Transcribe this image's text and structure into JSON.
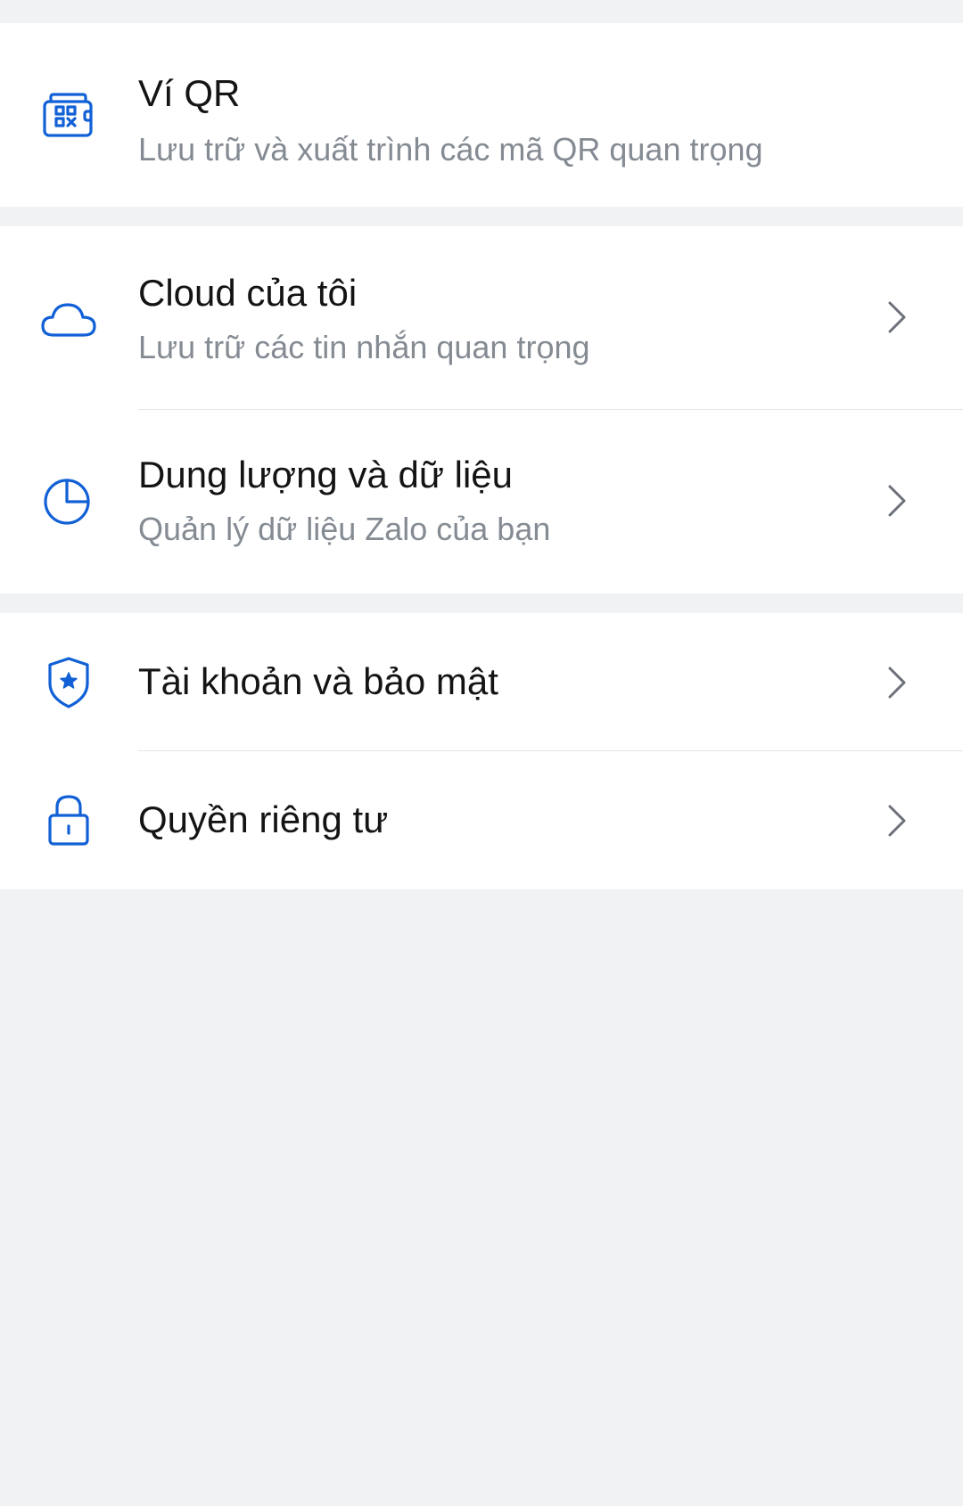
{
  "colors": {
    "accent": "#1160d6",
    "title": "#141414",
    "subtitle": "#858b93",
    "background": "#f1f2f4",
    "card": "#ffffff",
    "chevron": "#6b7078"
  },
  "sections": {
    "qr_wallet": {
      "icon": "qr-wallet-icon",
      "title": "Ví QR",
      "subtitle": "Lưu trữ và xuất trình các mã QR quan trọng"
    },
    "cloud": {
      "icon": "cloud-icon",
      "title": "Cloud của tôi",
      "subtitle": "Lưu trữ các tin nhắn quan trọng"
    },
    "storage": {
      "icon": "pie-chart-icon",
      "title": "Dung lượng và dữ liệu",
      "subtitle": "Quản lý dữ liệu Zalo của bạn"
    },
    "account_security": {
      "icon": "shield-star-icon",
      "title": "Tài khoản và bảo mật"
    },
    "privacy": {
      "icon": "lock-icon",
      "title": "Quyền riêng tư"
    }
  }
}
